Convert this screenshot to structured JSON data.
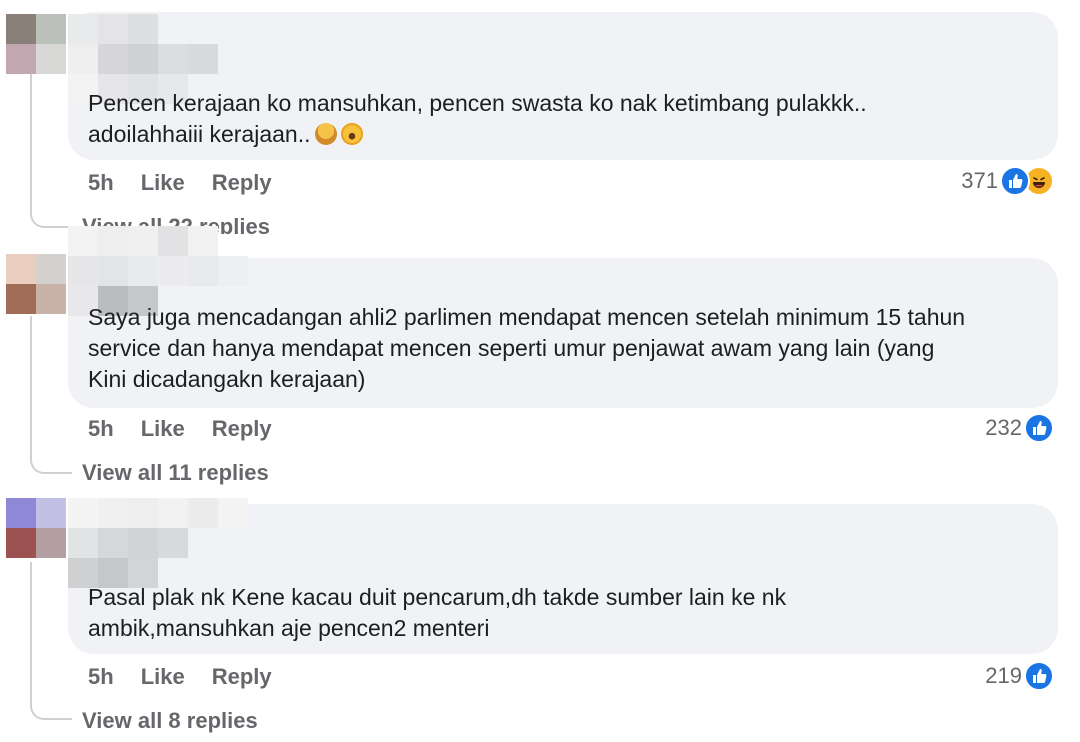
{
  "comments": [
    {
      "text": "Pencen kerajaan ko mansuhkan, pencen swasta ko nak ketimbang pulakkk..\nadoilahhaiii kerajaan..",
      "emojis": [
        "person-facepalming-emoji",
        "face-with-tears-of-joy-emoji"
      ],
      "time": "5h",
      "like": "Like",
      "reply": "Reply",
      "reaction_count": "371",
      "reactions": [
        "like",
        "haha"
      ],
      "view_replies": "View all 22 replies"
    },
    {
      "text": "Saya juga mencadangan ahli2 parlimen mendapat mencen setelah minimum 15 tahun\nservice dan hanya mendapat mencen seperti umur penjawat awam yang lain (yang\nKini dicadangakn kerajaan)",
      "time": "5h",
      "like": "Like",
      "reply": "Reply",
      "reaction_count": "232",
      "reactions": [
        "like"
      ],
      "view_replies": "View all 11 replies"
    },
    {
      "text": "Pasal plak nk Kene kacau duit pencarum,dh takde sumber lain ke nk\nambik,mansuhkan aje pencen2 menteri",
      "time": "5h",
      "like": "Like",
      "reply": "Reply",
      "reaction_count": "219",
      "reactions": [
        "like"
      ],
      "view_replies": "View all 8 replies"
    }
  ],
  "colors": {
    "bubble": "#f0f2f5",
    "meta_text": "#65676b",
    "like_blue": "#1b74e4",
    "haha_yellow": "#f7b125"
  }
}
